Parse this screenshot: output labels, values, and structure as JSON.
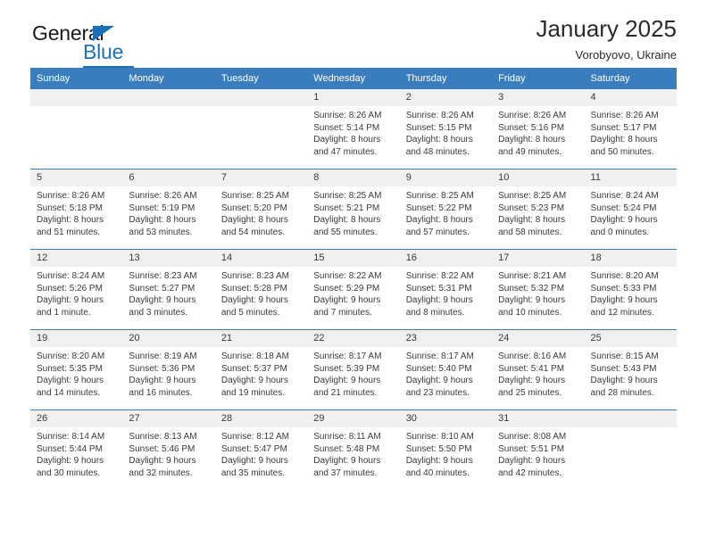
{
  "brand": {
    "name_top": "General",
    "name_bottom": "Blue"
  },
  "header": {
    "title": "January 2025",
    "location": "Vorobyovo, Ukraine"
  },
  "theme": {
    "header_blue": "#3a7dbf",
    "logo_blue": "#1b70b8",
    "daynum_bg": "#f0f0f0",
    "text": "#3a3a3a"
  },
  "weekday_headers": [
    "Sunday",
    "Monday",
    "Tuesday",
    "Wednesday",
    "Thursday",
    "Friday",
    "Saturday"
  ],
  "labels": {
    "sunrise": "Sunrise:",
    "sunset": "Sunset:",
    "daylight": "Daylight:"
  },
  "weeks": [
    [
      {
        "day": "",
        "empty": true
      },
      {
        "day": "",
        "empty": true
      },
      {
        "day": "",
        "empty": true
      },
      {
        "day": "1",
        "sunrise": "Sunrise: 8:26 AM",
        "sunset": "Sunset: 5:14 PM",
        "daylight1": "Daylight: 8 hours",
        "daylight2": "and 47 minutes."
      },
      {
        "day": "2",
        "sunrise": "Sunrise: 8:26 AM",
        "sunset": "Sunset: 5:15 PM",
        "daylight1": "Daylight: 8 hours",
        "daylight2": "and 48 minutes."
      },
      {
        "day": "3",
        "sunrise": "Sunrise: 8:26 AM",
        "sunset": "Sunset: 5:16 PM",
        "daylight1": "Daylight: 8 hours",
        "daylight2": "and 49 minutes."
      },
      {
        "day": "4",
        "sunrise": "Sunrise: 8:26 AM",
        "sunset": "Sunset: 5:17 PM",
        "daylight1": "Daylight: 8 hours",
        "daylight2": "and 50 minutes."
      }
    ],
    [
      {
        "day": "5",
        "sunrise": "Sunrise: 8:26 AM",
        "sunset": "Sunset: 5:18 PM",
        "daylight1": "Daylight: 8 hours",
        "daylight2": "and 51 minutes."
      },
      {
        "day": "6",
        "sunrise": "Sunrise: 8:26 AM",
        "sunset": "Sunset: 5:19 PM",
        "daylight1": "Daylight: 8 hours",
        "daylight2": "and 53 minutes."
      },
      {
        "day": "7",
        "sunrise": "Sunrise: 8:25 AM",
        "sunset": "Sunset: 5:20 PM",
        "daylight1": "Daylight: 8 hours",
        "daylight2": "and 54 minutes."
      },
      {
        "day": "8",
        "sunrise": "Sunrise: 8:25 AM",
        "sunset": "Sunset: 5:21 PM",
        "daylight1": "Daylight: 8 hours",
        "daylight2": "and 55 minutes."
      },
      {
        "day": "9",
        "sunrise": "Sunrise: 8:25 AM",
        "sunset": "Sunset: 5:22 PM",
        "daylight1": "Daylight: 8 hours",
        "daylight2": "and 57 minutes."
      },
      {
        "day": "10",
        "sunrise": "Sunrise: 8:25 AM",
        "sunset": "Sunset: 5:23 PM",
        "daylight1": "Daylight: 8 hours",
        "daylight2": "and 58 minutes."
      },
      {
        "day": "11",
        "sunrise": "Sunrise: 8:24 AM",
        "sunset": "Sunset: 5:24 PM",
        "daylight1": "Daylight: 9 hours",
        "daylight2": "and 0 minutes."
      }
    ],
    [
      {
        "day": "12",
        "sunrise": "Sunrise: 8:24 AM",
        "sunset": "Sunset: 5:26 PM",
        "daylight1": "Daylight: 9 hours",
        "daylight2": "and 1 minute."
      },
      {
        "day": "13",
        "sunrise": "Sunrise: 8:23 AM",
        "sunset": "Sunset: 5:27 PM",
        "daylight1": "Daylight: 9 hours",
        "daylight2": "and 3 minutes."
      },
      {
        "day": "14",
        "sunrise": "Sunrise: 8:23 AM",
        "sunset": "Sunset: 5:28 PM",
        "daylight1": "Daylight: 9 hours",
        "daylight2": "and 5 minutes."
      },
      {
        "day": "15",
        "sunrise": "Sunrise: 8:22 AM",
        "sunset": "Sunset: 5:29 PM",
        "daylight1": "Daylight: 9 hours",
        "daylight2": "and 7 minutes."
      },
      {
        "day": "16",
        "sunrise": "Sunrise: 8:22 AM",
        "sunset": "Sunset: 5:31 PM",
        "daylight1": "Daylight: 9 hours",
        "daylight2": "and 8 minutes."
      },
      {
        "day": "17",
        "sunrise": "Sunrise: 8:21 AM",
        "sunset": "Sunset: 5:32 PM",
        "daylight1": "Daylight: 9 hours",
        "daylight2": "and 10 minutes."
      },
      {
        "day": "18",
        "sunrise": "Sunrise: 8:20 AM",
        "sunset": "Sunset: 5:33 PM",
        "daylight1": "Daylight: 9 hours",
        "daylight2": "and 12 minutes."
      }
    ],
    [
      {
        "day": "19",
        "sunrise": "Sunrise: 8:20 AM",
        "sunset": "Sunset: 5:35 PM",
        "daylight1": "Daylight: 9 hours",
        "daylight2": "and 14 minutes."
      },
      {
        "day": "20",
        "sunrise": "Sunrise: 8:19 AM",
        "sunset": "Sunset: 5:36 PM",
        "daylight1": "Daylight: 9 hours",
        "daylight2": "and 16 minutes."
      },
      {
        "day": "21",
        "sunrise": "Sunrise: 8:18 AM",
        "sunset": "Sunset: 5:37 PM",
        "daylight1": "Daylight: 9 hours",
        "daylight2": "and 19 minutes."
      },
      {
        "day": "22",
        "sunrise": "Sunrise: 8:17 AM",
        "sunset": "Sunset: 5:39 PM",
        "daylight1": "Daylight: 9 hours",
        "daylight2": "and 21 minutes."
      },
      {
        "day": "23",
        "sunrise": "Sunrise: 8:17 AM",
        "sunset": "Sunset: 5:40 PM",
        "daylight1": "Daylight: 9 hours",
        "daylight2": "and 23 minutes."
      },
      {
        "day": "24",
        "sunrise": "Sunrise: 8:16 AM",
        "sunset": "Sunset: 5:41 PM",
        "daylight1": "Daylight: 9 hours",
        "daylight2": "and 25 minutes."
      },
      {
        "day": "25",
        "sunrise": "Sunrise: 8:15 AM",
        "sunset": "Sunset: 5:43 PM",
        "daylight1": "Daylight: 9 hours",
        "daylight2": "and 28 minutes."
      }
    ],
    [
      {
        "day": "26",
        "sunrise": "Sunrise: 8:14 AM",
        "sunset": "Sunset: 5:44 PM",
        "daylight1": "Daylight: 9 hours",
        "daylight2": "and 30 minutes."
      },
      {
        "day": "27",
        "sunrise": "Sunrise: 8:13 AM",
        "sunset": "Sunset: 5:46 PM",
        "daylight1": "Daylight: 9 hours",
        "daylight2": "and 32 minutes."
      },
      {
        "day": "28",
        "sunrise": "Sunrise: 8:12 AM",
        "sunset": "Sunset: 5:47 PM",
        "daylight1": "Daylight: 9 hours",
        "daylight2": "and 35 minutes."
      },
      {
        "day": "29",
        "sunrise": "Sunrise: 8:11 AM",
        "sunset": "Sunset: 5:48 PM",
        "daylight1": "Daylight: 9 hours",
        "daylight2": "and 37 minutes."
      },
      {
        "day": "30",
        "sunrise": "Sunrise: 8:10 AM",
        "sunset": "Sunset: 5:50 PM",
        "daylight1": "Daylight: 9 hours",
        "daylight2": "and 40 minutes."
      },
      {
        "day": "31",
        "sunrise": "Sunrise: 8:08 AM",
        "sunset": "Sunset: 5:51 PM",
        "daylight1": "Daylight: 9 hours",
        "daylight2": "and 42 minutes."
      },
      {
        "day": "",
        "empty": true
      }
    ]
  ]
}
